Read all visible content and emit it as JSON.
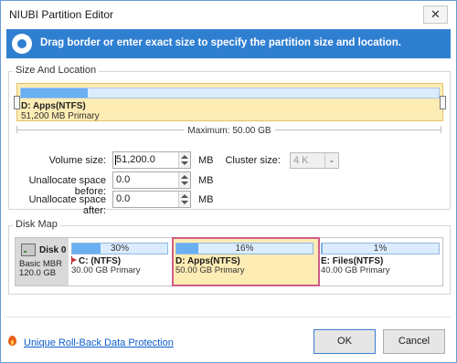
{
  "window": {
    "title": "NIUBI Partition Editor",
    "close_glyph": "✕"
  },
  "banner": {
    "text": "Drag border or enter exact size to specify the partition size and location.",
    "icon": "pie-chart-icon"
  },
  "size_location": {
    "group_label": "Size And Location",
    "partition_name": "D: Apps(NTFS)",
    "partition_detail": "51,200 MB Primary",
    "used_fraction": 0.16,
    "maximum_label": "Maximum: 50.00 GB"
  },
  "fields": {
    "volume_size": {
      "label": "Volume size:",
      "value": "51,200.0",
      "unit": "MB"
    },
    "unalloc_before": {
      "label": "Unallocate space before:",
      "value": "0.0",
      "unit": "MB"
    },
    "unalloc_after": {
      "label": "Unallocate space after:",
      "value": "0.0",
      "unit": "MB"
    },
    "cluster_size": {
      "label": "Cluster size:",
      "value": "4 K"
    }
  },
  "disk_map": {
    "group_label": "Disk Map",
    "disk": {
      "name": "Disk 0",
      "type": "Basic MBR",
      "size": "120.0 GB"
    },
    "partitions": [
      {
        "pct": "30%",
        "used": 0.3,
        "name": "C: (NTFS)",
        "detail": "30.00 GB Primary"
      },
      {
        "pct": "16%",
        "used": 0.16,
        "name": "D: Apps(NTFS)",
        "detail": "50.00 GB Primary"
      },
      {
        "pct": "1%",
        "used": 0.01,
        "name": "E: Files(NTFS)",
        "detail": "40.00 GB Primary"
      }
    ]
  },
  "footer": {
    "link": "Unique Roll-Back Data Protection",
    "ok": "OK",
    "cancel": "Cancel"
  },
  "colors": {
    "accent": "#2f7fd1",
    "selected_bg": "#fdecb4",
    "selected_border": "#d25c8a",
    "used_fill": "#6aaff2"
  }
}
